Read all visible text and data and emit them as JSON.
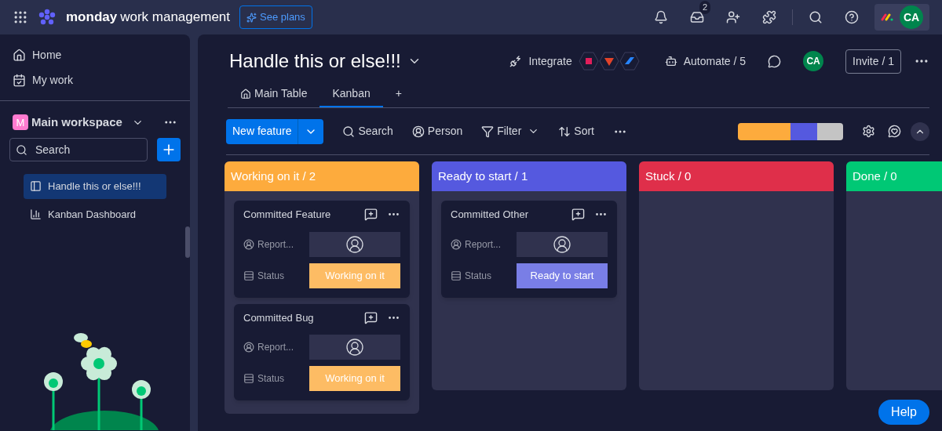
{
  "topbar": {
    "brand_bold": "monday",
    "brand_rest": "work management",
    "see_plans": "See plans",
    "inbox_badge": "2",
    "avatar": "CA"
  },
  "sidebar": {
    "nav": [
      {
        "kind": "home",
        "label": "Home"
      },
      {
        "kind": "mywork",
        "label": "My work"
      }
    ],
    "workspace": {
      "initial": "M",
      "name": "Main workspace"
    },
    "search": {
      "placeholder": "Search"
    },
    "boards": [
      {
        "kind": "board",
        "label": "Handle this or else!!!",
        "selected": true
      },
      {
        "kind": "dashboard",
        "label": "Kanban Dashboard",
        "selected": false
      }
    ]
  },
  "board": {
    "title": "Handle this or else!!!",
    "integrate": "Integrate",
    "automate": "Automate / 5",
    "avatar": "CA",
    "invite": "Invite / 1",
    "tabs": [
      {
        "label": "Main Table",
        "kind": "home",
        "selected": false
      },
      {
        "label": "Kanban",
        "kind": "plain",
        "selected": true
      },
      {
        "label": "+",
        "kind": "add",
        "selected": false
      }
    ],
    "toolbar": {
      "new_item": "New feature",
      "search": "Search",
      "person": "Person",
      "filter": "Filter",
      "sort": "Sort"
    },
    "columns": [
      {
        "title": "Working on it / 2",
        "color": "#fdab3d",
        "cards": [
          {
            "name": "Committed Feature",
            "person_label": "Report...",
            "status_label": "Status",
            "status": "Working on it",
            "color": "#fdbc64"
          },
          {
            "name": "Committed Bug",
            "person_label": "Report...",
            "status_label": "Status",
            "status": "Working on it",
            "color": "#fdbc64"
          }
        ]
      },
      {
        "title": "Ready to start / 1",
        "color": "#5559df",
        "cards": [
          {
            "name": "Committed Other",
            "person_label": "Report...",
            "status_label": "Status",
            "status": "Ready to start",
            "color": "#797ee6"
          }
        ]
      },
      {
        "title": "Stuck / 0",
        "color": "#df2f4a"
      },
      {
        "title": "Done / 0",
        "color": "#00c875"
      }
    ]
  },
  "help": "Help"
}
